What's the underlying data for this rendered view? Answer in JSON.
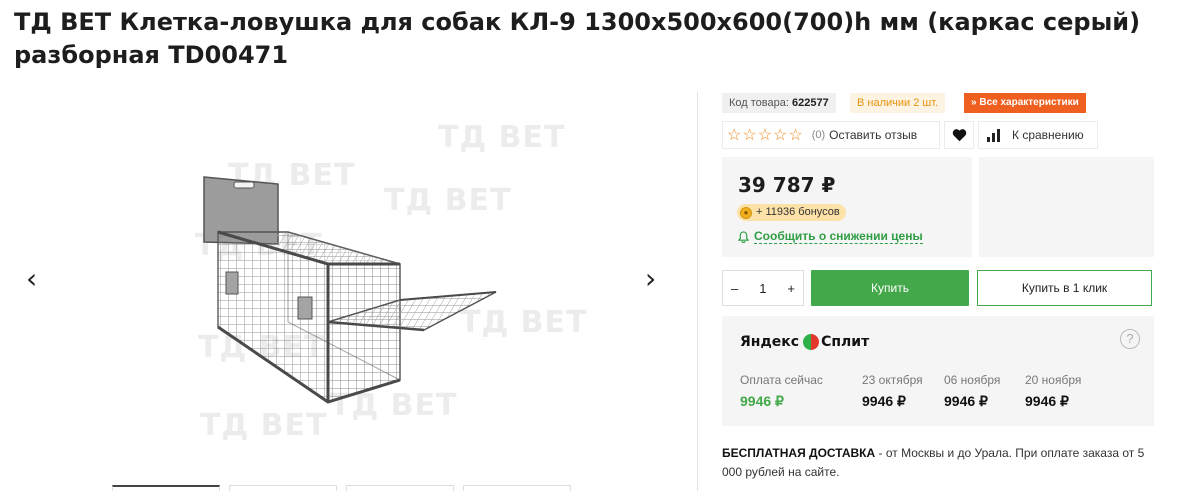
{
  "product": {
    "title": "ТД ВЕТ Клетка-ловушка для собак КЛ-9 1300х500х600(700)h мм (каркас серый) разборная TD00471"
  },
  "gallery": {
    "watermark": "ТД ВЕТ",
    "prev_arrow": "‹",
    "next_arrow": "›",
    "thumb_count": 4
  },
  "tags": {
    "code_label": "Код товара:",
    "code_value": "622577",
    "stock": "В наличии 2 шт.",
    "characteristics": "Все характеристики",
    "characteristics_icon": "double-chevron-down-icon"
  },
  "reviews": {
    "stars_filled": 0,
    "stars_total": 5,
    "count": "(0)",
    "leave_review": "Оставить отзыв"
  },
  "compare": {
    "label": "К сравнению"
  },
  "price": {
    "value": "39 787 ₽",
    "bonus": "+ 11936 бонусов",
    "notify": "Сообщить о снижении цены"
  },
  "cart": {
    "quantity": "1",
    "minus": "–",
    "plus": "+",
    "buy": "Купить",
    "buy_one_click": "Купить в 1 клик"
  },
  "split": {
    "brand_left": "Яндекс",
    "brand_right": "Сплит",
    "help": "?",
    "payments": [
      {
        "label": "Оплата сейчас",
        "amount": "9946 ₽"
      },
      {
        "label": "23 октября",
        "amount": "9946 ₽"
      },
      {
        "label": "06 ноября",
        "amount": "9946 ₽"
      },
      {
        "label": "20 ноября",
        "amount": "9946 ₽"
      }
    ]
  },
  "delivery": {
    "bold": "БЕСПЛАТНАЯ ДОСТАВКА",
    "text": " - от Москвы и до Урала. При оплате заказа от 5 000 рублей на сайте."
  },
  "colors": {
    "accent_green": "#43a849",
    "accent_orange": "#ef5f1f",
    "stock_orange": "#e8930f",
    "star_orange": "#f08a1e"
  }
}
